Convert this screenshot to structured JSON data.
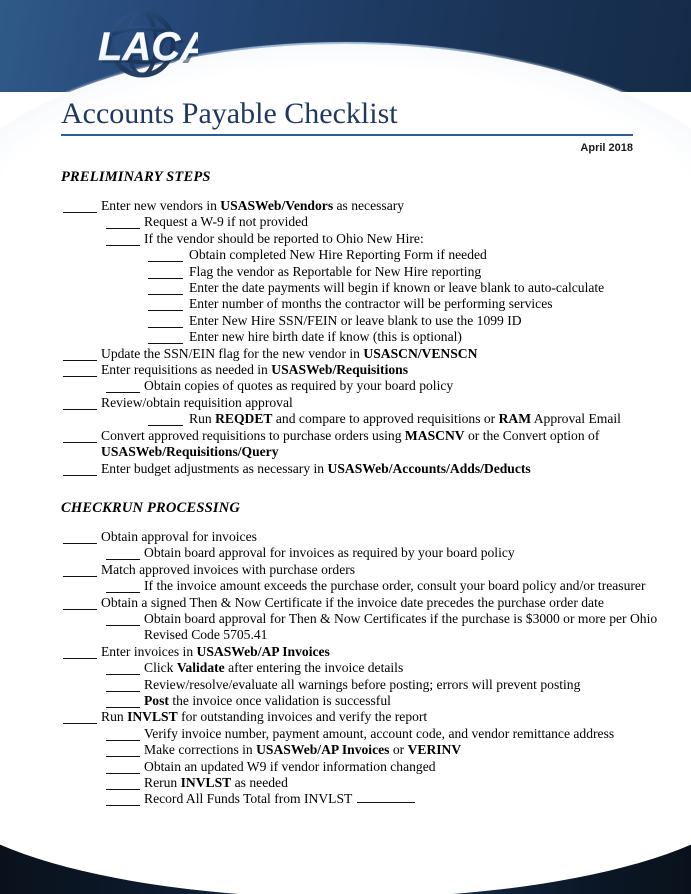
{
  "header": {
    "logo_text": "LACA",
    "logo_icon": "globe-swirl-icon"
  },
  "document": {
    "title": "Accounts Payable Checklist",
    "date": "April 2018"
  },
  "sections": [
    {
      "heading": "PRELIMINARY STEPS",
      "items": [
        {
          "level": 1,
          "text": "Enter new vendors in ",
          "bold": "USASWeb/Vendors",
          "text_after": " as necessary"
        },
        {
          "level": 2,
          "text": "Request a W-9 if not provided"
        },
        {
          "level": 2,
          "text": "If the vendor should be reported to Ohio New Hire:"
        },
        {
          "level": 3,
          "text": "Obtain completed New Hire Reporting Form if needed"
        },
        {
          "level": 3,
          "text": "Flag the vendor as Reportable for New Hire reporting"
        },
        {
          "level": 3,
          "text": "Enter the date payments will begin if known or leave blank to auto-calculate"
        },
        {
          "level": 3,
          "text": "Enter number of months the contractor will be performing services"
        },
        {
          "level": 3,
          "text": "Enter New Hire SSN/FEIN or leave blank to use the 1099 ID"
        },
        {
          "level": 3,
          "text": "Enter new hire birth date if know (this is optional)"
        },
        {
          "level": 1,
          "text": "Update the SSN/EIN flag for the new vendor in ",
          "bold": "USASCN/VENSCN"
        },
        {
          "level": 1,
          "text": "Enter requisitions as needed in ",
          "bold": "USASWeb/Requisitions"
        },
        {
          "level": 2,
          "text": "Obtain copies of quotes as required by your board policy"
        },
        {
          "level": 1,
          "text": "Review/obtain requisition approval"
        },
        {
          "level": 3,
          "text": "Run ",
          "bold": "REQDET",
          "text_after": " and compare to approved requisitions or ",
          "bold2": "RAM",
          "text_after2": " Approval Email"
        },
        {
          "level": 1,
          "text": "Convert approved requisitions to purchase orders using ",
          "bold": "MASCNV",
          "text_after": " or the Convert option of ",
          "bold2": "USASWeb/Requisitions/Query"
        },
        {
          "level": 1,
          "text": "Enter budget adjustments as necessary in ",
          "bold": "USASWeb/Accounts/Adds/Deducts"
        }
      ]
    },
    {
      "heading": "CHECKRUN PROCESSING",
      "items": [
        {
          "level": 1,
          "text": "Obtain approval for invoices"
        },
        {
          "level": 2,
          "text": "Obtain board approval for invoices as required by your board policy"
        },
        {
          "level": 1,
          "text": "Match approved invoices with purchase orders"
        },
        {
          "level": 2,
          "text": "If the invoice amount exceeds the purchase order, consult your board policy and/or treasurer"
        },
        {
          "level": 1,
          "text": "Obtain a signed Then & Now Certificate if the invoice date precedes the purchase order date"
        },
        {
          "level": 2,
          "text": "Obtain board approval for Then & Now Certificates if the purchase is $3000 or more per Ohio Revised Code 5705.41"
        },
        {
          "level": 1,
          "text": "Enter invoices in ",
          "bold": "USASWeb/AP Invoices"
        },
        {
          "level": 2,
          "text": "Click ",
          "bold": "Validate",
          "text_after": " after entering the invoice details"
        },
        {
          "level": 2,
          "text": "Review/resolve/evaluate all warnings before posting; errors will prevent posting"
        },
        {
          "level": 2,
          "bold_first": "Post",
          "text_after": " the invoice once validation is successful"
        },
        {
          "level": 1,
          "text": "Run ",
          "bold": "INVLST",
          "text_after": " for outstanding invoices and verify the report"
        },
        {
          "level": 2,
          "text": "Verify invoice number, payment amount, account code, and vendor remittance address"
        },
        {
          "level": 2,
          "text": "Make corrections in ",
          "bold": "USASWeb/AP Invoices",
          "text_after": " or ",
          "bold2": "VERINV"
        },
        {
          "level": 2,
          "text": "Obtain an updated W9 if vendor information changed"
        },
        {
          "level": 2,
          "text": "Rerun ",
          "bold": "INVLST",
          "text_after": " as needed"
        },
        {
          "level": 2,
          "text": "Record All Funds Total from INVLST",
          "trailing_blank": true
        }
      ]
    }
  ],
  "colors": {
    "header_blue_light": "#2f5a88",
    "header_blue_dark": "#142b48",
    "title_blue": "#1f3864",
    "rule_blue": "#2e5c9a",
    "footer_navy": "#16304f",
    "footer_edge": "#09121c"
  }
}
